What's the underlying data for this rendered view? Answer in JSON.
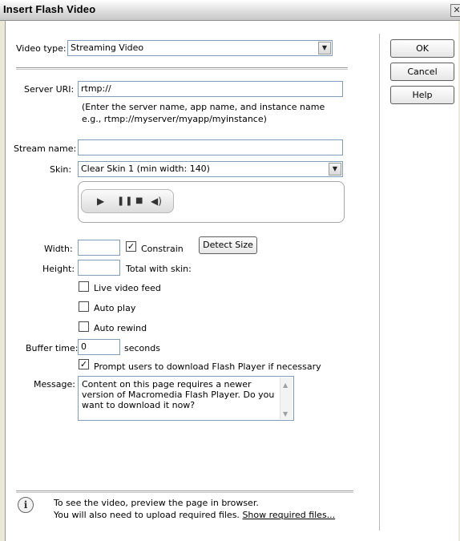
{
  "window": {
    "title": "Insert Flash Video"
  },
  "video_type": {
    "label": "Video type:",
    "value": "Streaming Video"
  },
  "server_uri": {
    "label": "Server URI:",
    "value": "rtmp://",
    "help_line1": "(Enter the server name, app name, and instance name",
    "help_line2": "e.g., rtmp://myserver/myapp/myinstance)"
  },
  "stream_name": {
    "label": "Stream name:",
    "value": ""
  },
  "skin": {
    "label": "Skin:",
    "value": "Clear Skin 1 (min width: 140)"
  },
  "player_preview": {
    "icons": [
      "play-icon",
      "pause-icon",
      "stop-icon",
      "volume-icon"
    ]
  },
  "width": {
    "label": "Width:",
    "value": ""
  },
  "constrain": {
    "label": "Constrain",
    "checked": true
  },
  "detect_size": {
    "label": "Detect Size"
  },
  "height": {
    "label": "Height:",
    "value": "",
    "total_with_skin": "Total with skin:"
  },
  "live_feed": {
    "label": "Live video feed",
    "checked": false
  },
  "auto_play": {
    "label": "Auto play",
    "checked": false
  },
  "auto_rewind": {
    "label": "Auto rewind",
    "checked": false
  },
  "buffer_time": {
    "label": "Buffer time:",
    "value": "0",
    "unit": "seconds"
  },
  "prompt": {
    "label": "Prompt users to download Flash Player if necessary",
    "checked": true
  },
  "message": {
    "label": "Message:",
    "text": "Content on this page requires a newer version of Macromedia Flash Player. Do you want to download it now?"
  },
  "buttons": {
    "ok": "OK",
    "cancel": "Cancel",
    "help": "Help"
  },
  "footer": {
    "line1": "To see the video, preview the page in browser.",
    "line2_prefix": "You will also need to upload required files.",
    "link": "Show required files..."
  },
  "check_mark": "✓"
}
